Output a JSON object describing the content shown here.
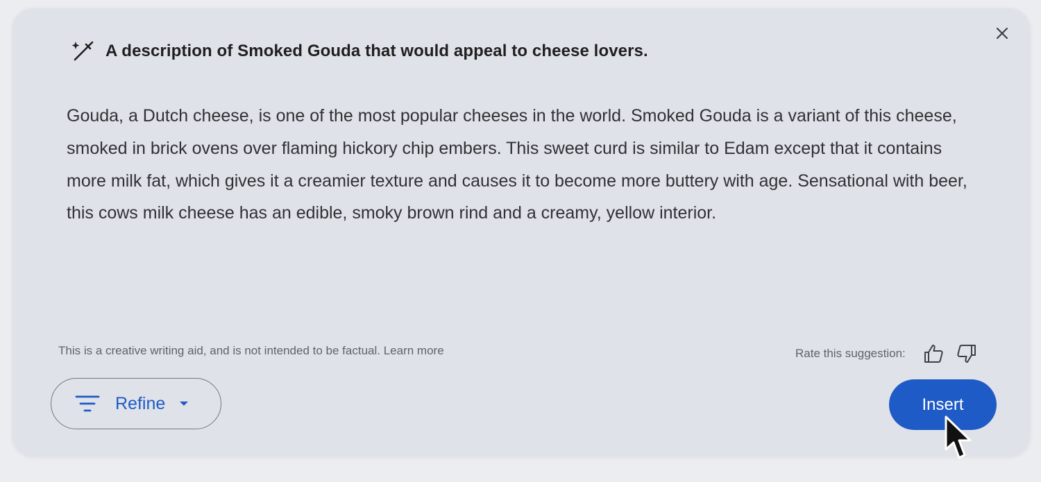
{
  "dialog": {
    "title": "A description of Smoked Gouda that would appeal to cheese lovers.",
    "title_icon": "magic-wand-icon",
    "close_icon": "close-icon",
    "body": "Gouda, a Dutch cheese, is one of the most popular cheeses in the world. Smoked Gouda is a variant of this cheese, smoked in brick ovens over flaming hickory chip embers. This sweet curd is similar to Edam except that it contains more milk fat, which gives it a creamier texture and causes it to become more buttery with age. Sensational with beer, this cows milk cheese has an edible, smoky brown rind and a creamy, yellow interior."
  },
  "footer": {
    "disclaimer": "This is a creative writing aid, and is not intended to be factual.",
    "learn_more": "Learn more",
    "rate_label": "Rate this suggestion:",
    "thumbs_up_icon": "thumbs-up-icon",
    "thumbs_down_icon": "thumbs-down-icon"
  },
  "actions": {
    "refine_label": "Refine",
    "refine_icon": "filter-icon",
    "refine_caret_icon": "caret-down-icon",
    "insert_label": "Insert"
  },
  "colors": {
    "accent": "#1e5bc6",
    "panel_background": "#e0e2e9"
  }
}
